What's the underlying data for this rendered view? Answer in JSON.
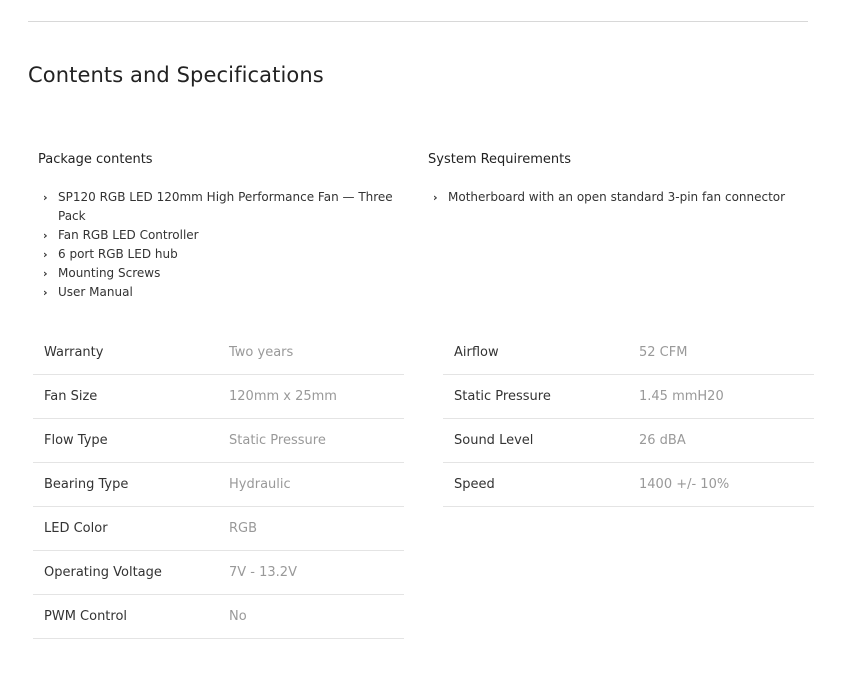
{
  "section": {
    "title": "Contents and Specifications"
  },
  "package_contents": {
    "title": "Package contents",
    "items": [
      "SP120 RGB LED 120mm High Performance Fan — Three Pack",
      "Fan RGB LED Controller",
      "6 port RGB LED hub",
      "Mounting Screws",
      "User Manual"
    ]
  },
  "system_requirements": {
    "title": "System Requirements",
    "items": [
      "Motherboard with an open standard 3-pin fan connector"
    ]
  },
  "specs_left": [
    {
      "label": "Warranty",
      "value": "Two years"
    },
    {
      "label": "Fan Size",
      "value": "120mm x 25mm"
    },
    {
      "label": "Flow Type",
      "value": "Static Pressure"
    },
    {
      "label": "Bearing Type",
      "value": "Hydraulic"
    },
    {
      "label": "LED Color",
      "value": "RGB"
    },
    {
      "label": "Operating Voltage",
      "value": "7V - 13.2V"
    },
    {
      "label": "PWM Control",
      "value": "No"
    }
  ],
  "specs_right": [
    {
      "label": "Airflow",
      "value": "52 CFM"
    },
    {
      "label": "Static Pressure",
      "value": "1.45 mmH20"
    },
    {
      "label": "Sound Level",
      "value": "26 dBA"
    },
    {
      "label": "Speed",
      "value": "1400 +/- 10%"
    }
  ],
  "icons": {
    "bullet": "chevron-right-icon"
  }
}
